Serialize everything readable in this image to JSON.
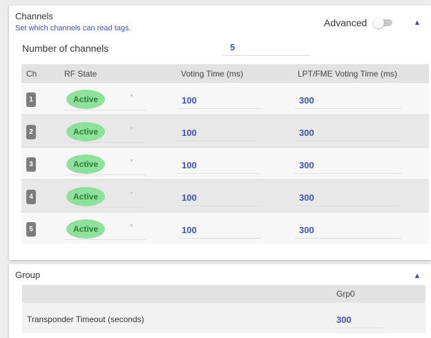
{
  "channels": {
    "title": "Channels",
    "subtitle": "Set which channels can read tags.",
    "advanced_label": "Advanced",
    "advanced_enabled": false,
    "collapse_icon": "chevron-up-icon",
    "number_label": "Number of channels",
    "number_value": "5",
    "columns": [
      "Ch",
      "RF State",
      "Voting Time (ms)",
      "LPT/FME Voting Time (ms)"
    ],
    "rows": [
      {
        "ch": "1",
        "rf_state": "Active",
        "voting_time": "100",
        "lpt_voting_time": "300"
      },
      {
        "ch": "2",
        "rf_state": "Active",
        "voting_time": "100",
        "lpt_voting_time": "300"
      },
      {
        "ch": "3",
        "rf_state": "Active",
        "voting_time": "100",
        "lpt_voting_time": "300"
      },
      {
        "ch": "4",
        "rf_state": "Active",
        "voting_time": "100",
        "lpt_voting_time": "300"
      },
      {
        "ch": "5",
        "rf_state": "Active",
        "voting_time": "100",
        "lpt_voting_time": "300"
      }
    ]
  },
  "group": {
    "title": "Group",
    "collapse_icon": "chevron-up-icon",
    "column_header": "Grp0",
    "row_label": "Transponder Timeout (seconds)",
    "row_value": "300"
  },
  "colors": {
    "accent": "#3f51b5",
    "active_pill": "#8fdf9d",
    "active_text": "#2e7d32",
    "badge": "#7d7d7d"
  }
}
